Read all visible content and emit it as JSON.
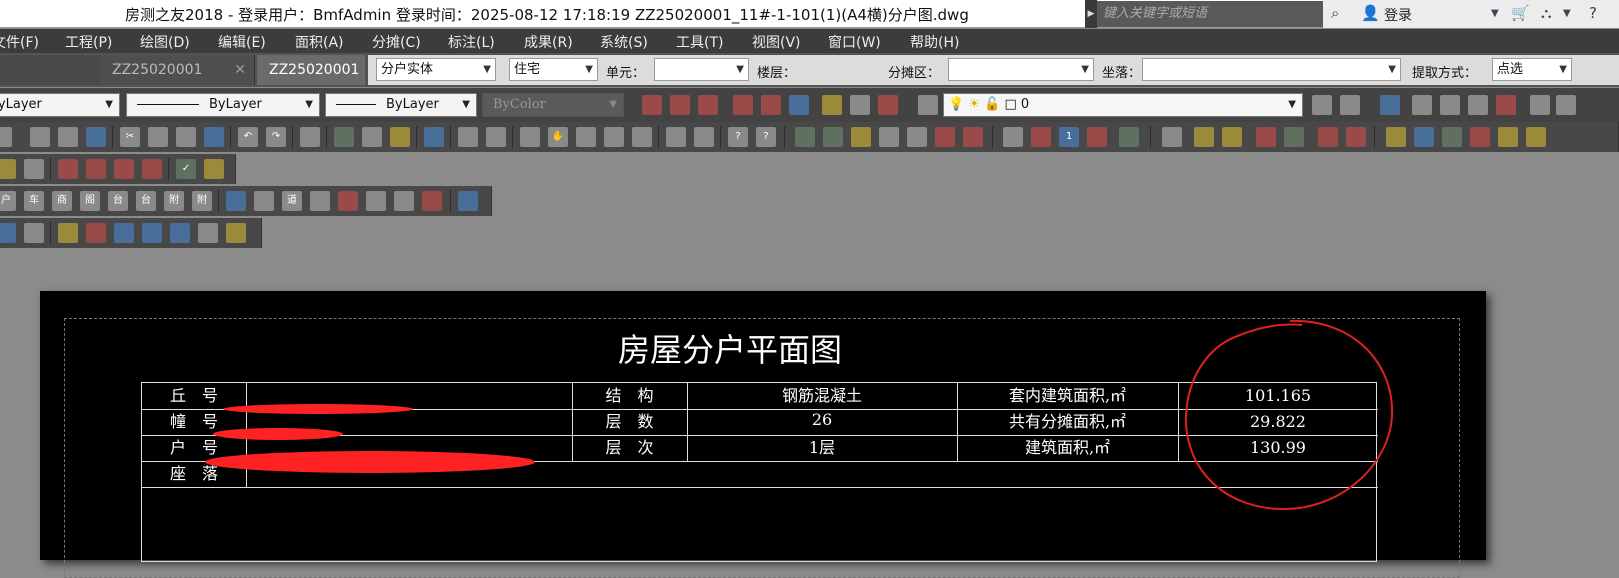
{
  "titlebar": {
    "title": "房测之友2018 - 登录用户：BmfAdmin   登录时间：2025-08-12 17:18:19    ZZ25020001_11#-1-101(1)(A4横)分户图.dwg",
    "search_placeholder": "键入关键字或短语",
    "login_label": "登录"
  },
  "menu": [
    "文件(F)",
    "工程(P)",
    "绘图(D)",
    "编辑(E)",
    "面积(A)",
    "分摊(C)",
    "标注(L)",
    "成果(R)",
    "系统(S)",
    "工具(T)",
    "视图(V)",
    "窗口(W)",
    "帮助(H)"
  ],
  "tabs": [
    {
      "label": "ZZ25020001"
    },
    {
      "label": "ZZ25020001"
    }
  ],
  "propbar": {
    "entity_type": "分户实体",
    "usage": "住宅",
    "unit_label": "单元：",
    "unit_value": "",
    "floor_label": "楼层：",
    "district_label": "分摊区：",
    "district_value": "",
    "location_label": "坐落：",
    "location_value": "",
    "method_label": "提取方式：",
    "method_value": "点选"
  },
  "layerbar": {
    "layer": "ByLayer",
    "linetype": "ByLayer",
    "lineweight": "ByLayer",
    "color": "ByColor",
    "current_layer": "0"
  },
  "drawing": {
    "title": "房屋分户平面图",
    "rows": [
      {
        "label": "丘　号",
        "struct_label": "结　构",
        "struct_value": "钢筋混凝土",
        "area_label": "套内建筑面积,㎡",
        "area_value": "101.165"
      },
      {
        "label": "幢　号",
        "struct_label": "层　数",
        "struct_value": "26",
        "area_label": "共有分摊面积,㎡",
        "area_value": "29.822"
      },
      {
        "label": "户　号",
        "struct_label": "层　次",
        "struct_value": "1层",
        "area_label": "建筑面积,㎡",
        "area_value": "130.99"
      },
      {
        "label": "座　落"
      }
    ]
  },
  "colors": {
    "redaction": "#ff2222",
    "annotation": "#e02020",
    "canvas": "#000000",
    "workspace": "#8b8b8b"
  }
}
